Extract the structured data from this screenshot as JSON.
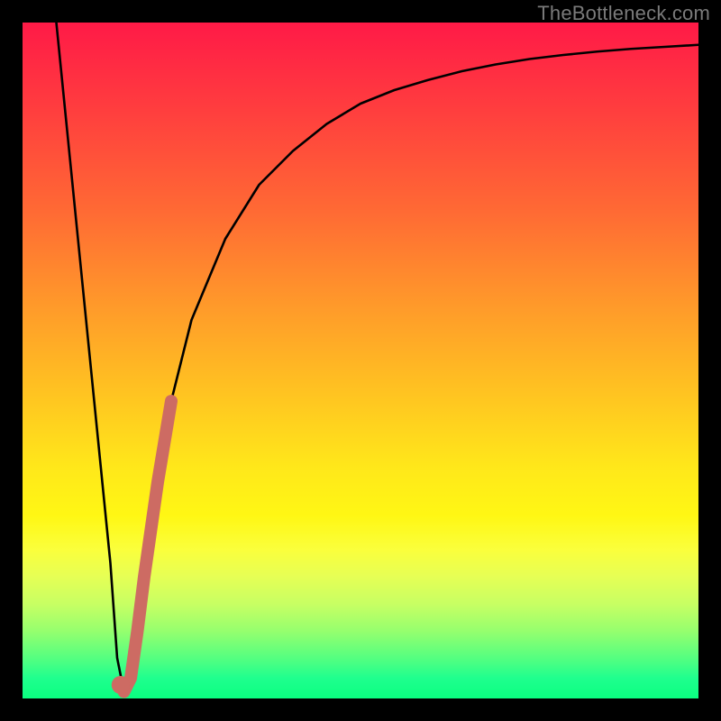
{
  "watermark": "TheBottleneck.com",
  "chart_data": {
    "type": "line",
    "title": "",
    "xlabel": "",
    "ylabel": "",
    "xlim": [
      0,
      100
    ],
    "ylim": [
      0,
      100
    ],
    "series": [
      {
        "name": "bottleneck-curve",
        "x": [
          5,
          7,
          9,
          11,
          13,
          14,
          15,
          16,
          18,
          20,
          22,
          25,
          30,
          35,
          40,
          45,
          50,
          55,
          60,
          65,
          70,
          75,
          80,
          85,
          90,
          95,
          100
        ],
        "y": [
          100,
          80,
          60,
          40,
          20,
          6,
          1,
          3,
          18,
          32,
          44,
          56,
          68,
          76,
          81,
          85,
          88,
          90,
          91.5,
          92.8,
          93.8,
          94.6,
          95.2,
          95.7,
          96.1,
          96.4,
          96.7
        ]
      }
    ],
    "highlight": {
      "name": "highlight-segment",
      "color": "#cd6b63",
      "x": [
        14.5,
        15,
        16,
        17,
        18,
        19,
        20,
        21,
        22
      ],
      "y": [
        2,
        1,
        3,
        10,
        18,
        25,
        32,
        38,
        44
      ]
    }
  }
}
